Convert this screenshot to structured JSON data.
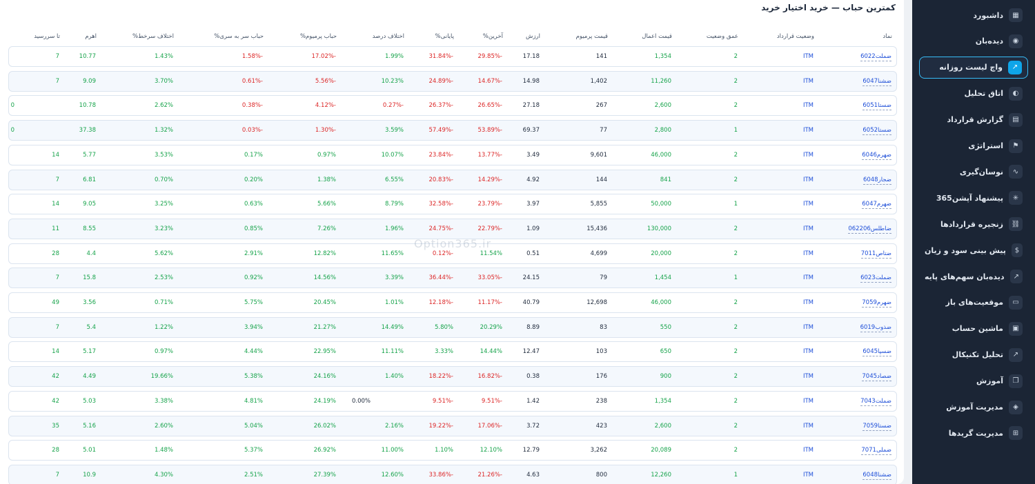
{
  "card_title": "کمترین حباب — خرید اختیار خرید",
  "watermark": "Option365.ir",
  "columns": [
    "نماد",
    "وضعیت قرارداد",
    "عمق وضعیت",
    "قیمت اعمال",
    "قیمت پرمیوم",
    "ارزش",
    "%آخرین",
    "%پایانی",
    "اختلاف درصد",
    "%حباب پرمیوم",
    "%حباب سر به سری",
    "%اختلاف سرخط",
    "اهرم",
    "تا سررسید"
  ],
  "rows": [
    {
      "symbol": "ضملت6022",
      "status": "ITM",
      "depth": "2",
      "strike": "1,354",
      "premium": "141",
      "value": "17.18",
      "last": "29.85%-",
      "final": "31.84%-",
      "diff": "1.99%",
      "prem_bubble": "17.02%-",
      "be_bubble": "1.58%-",
      "line_diff": "1.43%",
      "leverage": "10.77",
      "days": "7"
    },
    {
      "symbol": "ضشنا6047",
      "status": "ITM",
      "depth": "2",
      "strike": "11,260",
      "premium": "1,402",
      "value": "14.98",
      "last": "14.67%-",
      "final": "24.89%-",
      "diff": "10.23%",
      "prem_bubble": "5.56%-",
      "be_bubble": "0.61%-",
      "line_diff": "3.70%",
      "leverage": "9.09",
      "days": "7"
    },
    {
      "symbol": "ضستا6051",
      "status": "ITM",
      "depth": "2",
      "strike": "2,600",
      "premium": "267",
      "value": "27.18",
      "last": "26.65%-",
      "final": "26.37%-",
      "diff": "0.27%-",
      "prem_bubble": "4.12%-",
      "be_bubble": "0.38%-",
      "line_diff": "2.62%",
      "leverage": "10.78",
      "days": "0"
    },
    {
      "symbol": "ضستا6052",
      "status": "ITM",
      "depth": "1",
      "strike": "2,800",
      "premium": "77",
      "value": "69.37",
      "last": "53.89%-",
      "final": "57.49%-",
      "diff": "3.59%",
      "prem_bubble": "1.30%-",
      "be_bubble": "0.03%-",
      "line_diff": "1.32%",
      "leverage": "37.38",
      "days": "0"
    },
    {
      "symbol": "ضهرم6046",
      "status": "ITM",
      "depth": "2",
      "strike": "46,000",
      "premium": "9,601",
      "value": "3.49",
      "last": "13.77%-",
      "final": "23.84%-",
      "diff": "10.07%",
      "prem_bubble": "0.97%",
      "be_bubble": "0.17%",
      "line_diff": "3.53%",
      "leverage": "5.77",
      "days": "14"
    },
    {
      "symbol": "ضجار6048",
      "status": "ITM",
      "depth": "2",
      "strike": "841",
      "premium": "144",
      "value": "4.92",
      "last": "14.29%-",
      "final": "20.83%-",
      "diff": "6.55%",
      "prem_bubble": "1.38%",
      "be_bubble": "0.20%",
      "line_diff": "0.70%",
      "leverage": "6.81",
      "days": "7"
    },
    {
      "symbol": "ضهرم6047",
      "status": "ITM",
      "depth": "1",
      "strike": "50,000",
      "premium": "5,855",
      "value": "3.97",
      "last": "23.79%-",
      "final": "32.58%-",
      "diff": "8.79%",
      "prem_bubble": "5.66%",
      "be_bubble": "0.63%",
      "line_diff": "3.25%",
      "leverage": "9.05",
      "days": "14"
    },
    {
      "symbol": "ضاطلس062206",
      "status": "ITM",
      "depth": "2",
      "strike": "130,000",
      "premium": "15,436",
      "value": "1.09",
      "last": "22.79%-",
      "final": "24.75%-",
      "diff": "1.96%",
      "prem_bubble": "7.26%",
      "be_bubble": "0.85%",
      "line_diff": "3.23%",
      "leverage": "8.55",
      "days": "11"
    },
    {
      "symbol": "ضتاص7011",
      "status": "ITM",
      "depth": "2",
      "strike": "20,000",
      "premium": "4,699",
      "value": "0.51",
      "last": "11.54%",
      "final": "0.12%-",
      "diff": "11.65%",
      "prem_bubble": "12.82%",
      "be_bubble": "2.91%",
      "line_diff": "5.62%",
      "leverage": "4.4",
      "days": "28"
    },
    {
      "symbol": "ضملت6023",
      "status": "ITM",
      "depth": "1",
      "strike": "1,454",
      "premium": "79",
      "value": "24.15",
      "last": "33.05%-",
      "final": "36.44%-",
      "diff": "3.39%",
      "prem_bubble": "14.56%",
      "be_bubble": "0.92%",
      "line_diff": "2.53%",
      "leverage": "15.8",
      "days": "7"
    },
    {
      "symbol": "ضهرم7059",
      "status": "ITM",
      "depth": "2",
      "strike": "46,000",
      "premium": "12,698",
      "value": "40.79",
      "last": "11.17%-",
      "final": "12.18%-",
      "diff": "1.01%",
      "prem_bubble": "20.45%",
      "be_bubble": "5.75%",
      "line_diff": "0.71%",
      "leverage": "3.56",
      "days": "49"
    },
    {
      "symbol": "ضذوب6019",
      "status": "ITM",
      "depth": "2",
      "strike": "550",
      "premium": "83",
      "value": "8.89",
      "last": "20.29%",
      "final": "5.80%",
      "diff": "14.49%",
      "prem_bubble": "21.27%",
      "be_bubble": "3.94%",
      "line_diff": "1.22%",
      "leverage": "5.4",
      "days": "7"
    },
    {
      "symbol": "ضسپا6045",
      "status": "ITM",
      "depth": "2",
      "strike": "650",
      "premium": "103",
      "value": "12.47",
      "last": "14.44%",
      "final": "3.33%",
      "diff": "11.11%",
      "prem_bubble": "22.95%",
      "be_bubble": "4.44%",
      "line_diff": "0.97%",
      "leverage": "5.17",
      "days": "14"
    },
    {
      "symbol": "ضصاد7045",
      "status": "ITM",
      "depth": "2",
      "strike": "900",
      "premium": "176",
      "value": "0.38",
      "last": "16.82%-",
      "final": "18.22%-",
      "diff": "1.40%",
      "prem_bubble": "24.16%",
      "be_bubble": "5.38%",
      "line_diff": "19.66%",
      "leverage": "4.49",
      "days": "42"
    },
    {
      "symbol": "ضملت7043",
      "status": "ITM",
      "depth": "2",
      "strike": "1,354",
      "premium": "238",
      "value": "1.42",
      "last": "9.51%-",
      "final": "9.51%-",
      "diff": "0.00%",
      "prem_bubble": "24.19%",
      "be_bubble": "4.81%",
      "line_diff": "3.38%",
      "leverage": "5.03",
      "days": "42"
    },
    {
      "symbol": "ضستا7059",
      "status": "ITM",
      "depth": "2",
      "strike": "2,600",
      "premium": "423",
      "value": "3.72",
      "last": "17.06%-",
      "final": "19.22%-",
      "diff": "2.16%",
      "prem_bubble": "26.02%",
      "be_bubble": "5.04%",
      "line_diff": "2.60%",
      "leverage": "5.16",
      "days": "35"
    },
    {
      "symbol": "ضملی7071",
      "status": "ITM",
      "depth": "2",
      "strike": "20,089",
      "premium": "3,262",
      "value": "12.79",
      "last": "12.10%",
      "final": "1.10%",
      "diff": "11.00%",
      "prem_bubble": "26.92%",
      "be_bubble": "5.37%",
      "line_diff": "1.48%",
      "leverage": "5.01",
      "days": "28"
    },
    {
      "symbol": "ضشنا6048",
      "status": "ITM",
      "depth": "1",
      "strike": "12,260",
      "premium": "800",
      "value": "4.63",
      "last": "21.26%-",
      "final": "33.86%-",
      "diff": "12.60%",
      "prem_bubble": "27.39%",
      "be_bubble": "2.51%",
      "line_diff": "4.30%",
      "leverage": "10.9",
      "days": "7"
    }
  ],
  "sidebar": {
    "items": [
      {
        "label": "داشبورد",
        "icon": "grid-icon",
        "glyph": "▦"
      },
      {
        "label": "دیده‌بان",
        "icon": "eye-icon",
        "glyph": "◉"
      },
      {
        "label": "واچ لیست روزانه",
        "icon": "chart-icon",
        "glyph": "↗"
      },
      {
        "label": "اتاق تحلیل",
        "icon": "headset-icon",
        "glyph": "◐"
      },
      {
        "label": "گزارش قرارداد",
        "icon": "document-icon",
        "glyph": "▤"
      },
      {
        "label": "استراتژی",
        "icon": "flag-icon",
        "glyph": "⚑"
      },
      {
        "label": "نوسان‌گیری",
        "icon": "wave-icon",
        "glyph": "∿"
      },
      {
        "label": "پیشنهاد آپشن365",
        "icon": "sparkle-icon",
        "glyph": "✳"
      },
      {
        "label": "زنجیره قراردادها",
        "icon": "link-icon",
        "glyph": "⛓"
      },
      {
        "label": "پیش بینی سود و زیان",
        "icon": "dollar-icon",
        "glyph": "$"
      },
      {
        "label": "دیده‌بان سهم‌های پایه",
        "icon": "line-chart-icon",
        "glyph": "↗"
      },
      {
        "label": "موقعیت‌های باز",
        "icon": "keyboard-icon",
        "glyph": "▭"
      },
      {
        "label": "ماشین حساب",
        "icon": "calculator-icon",
        "glyph": "▣"
      },
      {
        "label": "تحلیل تکنیکال",
        "icon": "trend-icon",
        "glyph": "↗"
      },
      {
        "label": "آموزش",
        "icon": "book-icon",
        "glyph": "❐"
      },
      {
        "label": "مدیریت آموزش",
        "icon": "layers-icon",
        "glyph": "◈"
      },
      {
        "label": "مدیریت گریدها",
        "icon": "grid-plus-icon",
        "glyph": "⊞"
      }
    ],
    "active_index": 2
  },
  "colors": {
    "positive": "#16a34a",
    "negative": "#dc2626",
    "symbol": "#1d4ed8",
    "sidebar_bg": "#1b2535",
    "accent": "#0ea5e9"
  }
}
